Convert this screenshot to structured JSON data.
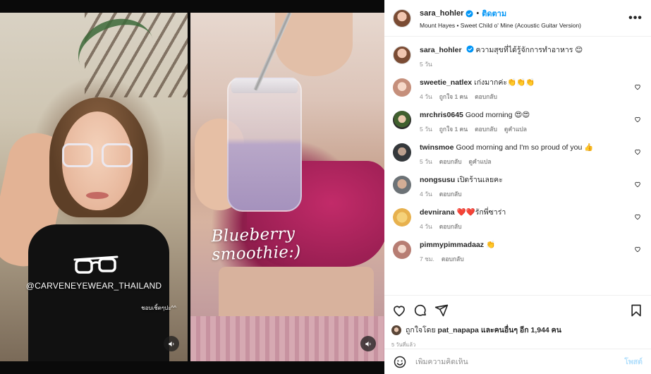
{
  "header": {
    "username": "sara_hohler",
    "follow_label": "ติดตาม",
    "dot": "•",
    "audio": "Mount Hayes • Sweet Child o' Mine (Acoustic Guitar Version)",
    "more": "•••"
  },
  "media": {
    "left_tag": "@CARVENEYEWEAR_THAILAND",
    "left_caption": "ชอบเชิ้ตๆปะ^^",
    "right_text": "Blueberry smoothie:)"
  },
  "caption": {
    "username": "sara_hohler",
    "text": "ความสุขที่ได้รู้จักการทำอาหาร 😊",
    "time": "5 วัน"
  },
  "comments": [
    {
      "user": "sweetie_natlex",
      "text": "เก่งมากค่ะ👏👏👏",
      "time": "4 วัน",
      "likes": "ถูกใจ 1 คน",
      "reply": "ตอบกลับ",
      "translate": ""
    },
    {
      "user": "mrchris0645",
      "text": "Good morning 😍😍",
      "time": "5 วัน",
      "likes": "ถูกใจ 1 คน",
      "reply": "ตอบกลับ",
      "translate": "ดูคำแปล"
    },
    {
      "user": "twinsmoe",
      "text": "Good morning and I'm so proud of you 👍",
      "time": "5 วัน",
      "likes": "",
      "reply": "ตอบกลับ",
      "translate": "ดูคำแปล"
    },
    {
      "user": "nongsusu",
      "text": "เปิดร้านเลยคะ",
      "time": "4 วัน",
      "likes": "",
      "reply": "ตอบกลับ",
      "translate": ""
    },
    {
      "user": "devnirana",
      "text": "❤️❤️รักพี่ซาร่า",
      "time": "4 วัน",
      "likes": "",
      "reply": "ตอบกลับ",
      "translate": ""
    },
    {
      "user": "pimmypimmadaaz",
      "text": "👏",
      "time": "7 ชม.",
      "likes": "",
      "reply": "ตอบกลับ",
      "translate": ""
    }
  ],
  "likes": {
    "prefix": "ถูกใจโดย",
    "user": "pat_napapa",
    "suffix": "และคนอื่นๆ อีก 1,944 คน"
  },
  "posted_ago": "5 วันที่แล้ว",
  "add_comment": {
    "placeholder": "เพิ่มความคิดเห็น",
    "post_label": "โพสต์"
  },
  "icons": [
    "verified-badge-icon",
    "more-icon",
    "heart-icon",
    "comment-icon",
    "share-icon",
    "bookmark-icon",
    "emoji-icon",
    "volume-icon"
  ],
  "colors": {
    "accent": "#0095f6",
    "post_disabled": "#b2dffc",
    "muted": "#8e8e8e",
    "text": "#262626"
  }
}
